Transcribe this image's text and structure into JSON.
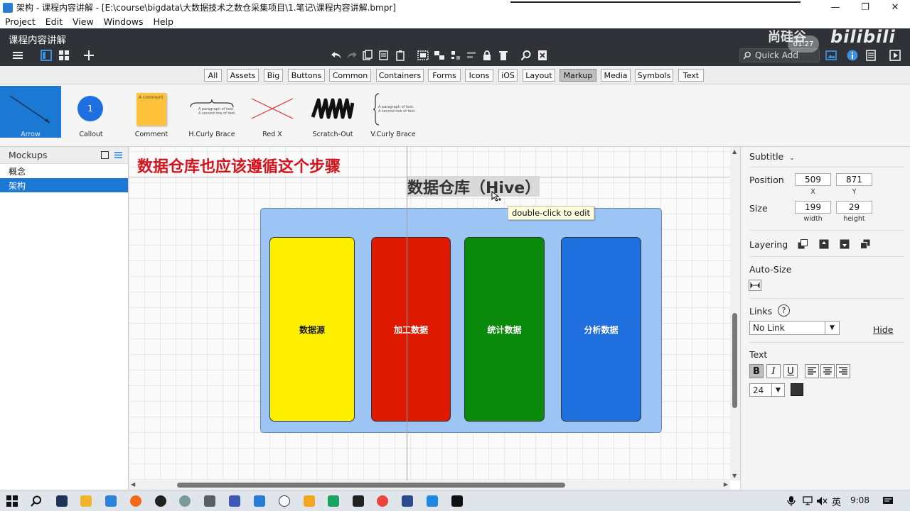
{
  "window": {
    "title": "架构 - 课程内容讲解 - [E:\\course\\bigdata\\大数据技术之数仓采集项目\\1.笔记\\课程内容讲解.bmpr]",
    "controls": [
      "—",
      "❐",
      "✕"
    ]
  },
  "menubar": [
    "Project",
    "Edit",
    "View",
    "Windows",
    "Help"
  ],
  "toolbar": {
    "project_title": "课程内容讲解",
    "quick_add_placeholder": "Quick Add",
    "watermark_text": "尚硅谷",
    "watermark_time": "01:27",
    "bilibili_text": "bilibili"
  },
  "filters": {
    "items": [
      "All",
      "Assets",
      "Big",
      "Buttons",
      "Common",
      "Containers",
      "Forms",
      "Icons",
      "iOS",
      "Layout",
      "Markup",
      "Media",
      "Symbols",
      "Text"
    ],
    "active": "Markup"
  },
  "library": {
    "items": [
      {
        "label": "Arrow",
        "selected": true
      },
      {
        "label": "Callout",
        "badge": "1"
      },
      {
        "label": "Comment",
        "note": "A comment"
      },
      {
        "label": "H.Curly Brace",
        "text1": "A paragraph of text.",
        "text2": "A second row of text."
      },
      {
        "label": "Red X"
      },
      {
        "label": "Scratch-Out"
      },
      {
        "label": "V.Curly Brace",
        "text1": "A paragraph of text.",
        "text2": "A second row of text."
      }
    ]
  },
  "mockups": {
    "header": "Mockups",
    "items": [
      "概念",
      "架构"
    ],
    "selected": "架构"
  },
  "canvas": {
    "red_title": "数据仓库也应该遵循这个步骤",
    "subtitle": "数据仓库（Hive）",
    "tooltip": "double-click to edit",
    "columns": [
      {
        "label": "数据源",
        "color": "#ffef00",
        "text_color": "#222222"
      },
      {
        "label": "加工数据",
        "color": "#dd1a00",
        "text_color": "#ffffff"
      },
      {
        "label": "统计数据",
        "color": "#0a8a0a",
        "text_color": "#ffffff"
      },
      {
        "label": "分析数据",
        "color": "#1f6fde",
        "text_color": "#ffffff"
      }
    ],
    "container_color": "#9cc4f5"
  },
  "properties": {
    "section": "Subtitle",
    "position_label": "Position",
    "position_x": "509",
    "position_y": "871",
    "x_label": "X",
    "y_label": "Y",
    "size_label": "Size",
    "width": "199",
    "height": "29",
    "width_label": "width",
    "height_label": "height",
    "layering_label": "Layering",
    "autosize_label": "Auto-Size",
    "links_label": "Links",
    "link_value": "No Link",
    "hide_label": "Hide",
    "text_label": "Text",
    "font_size": "24",
    "bold": "B",
    "italic": "I",
    "underline": "U"
  },
  "taskbar": {
    "ime": "英",
    "time": "9:08"
  }
}
